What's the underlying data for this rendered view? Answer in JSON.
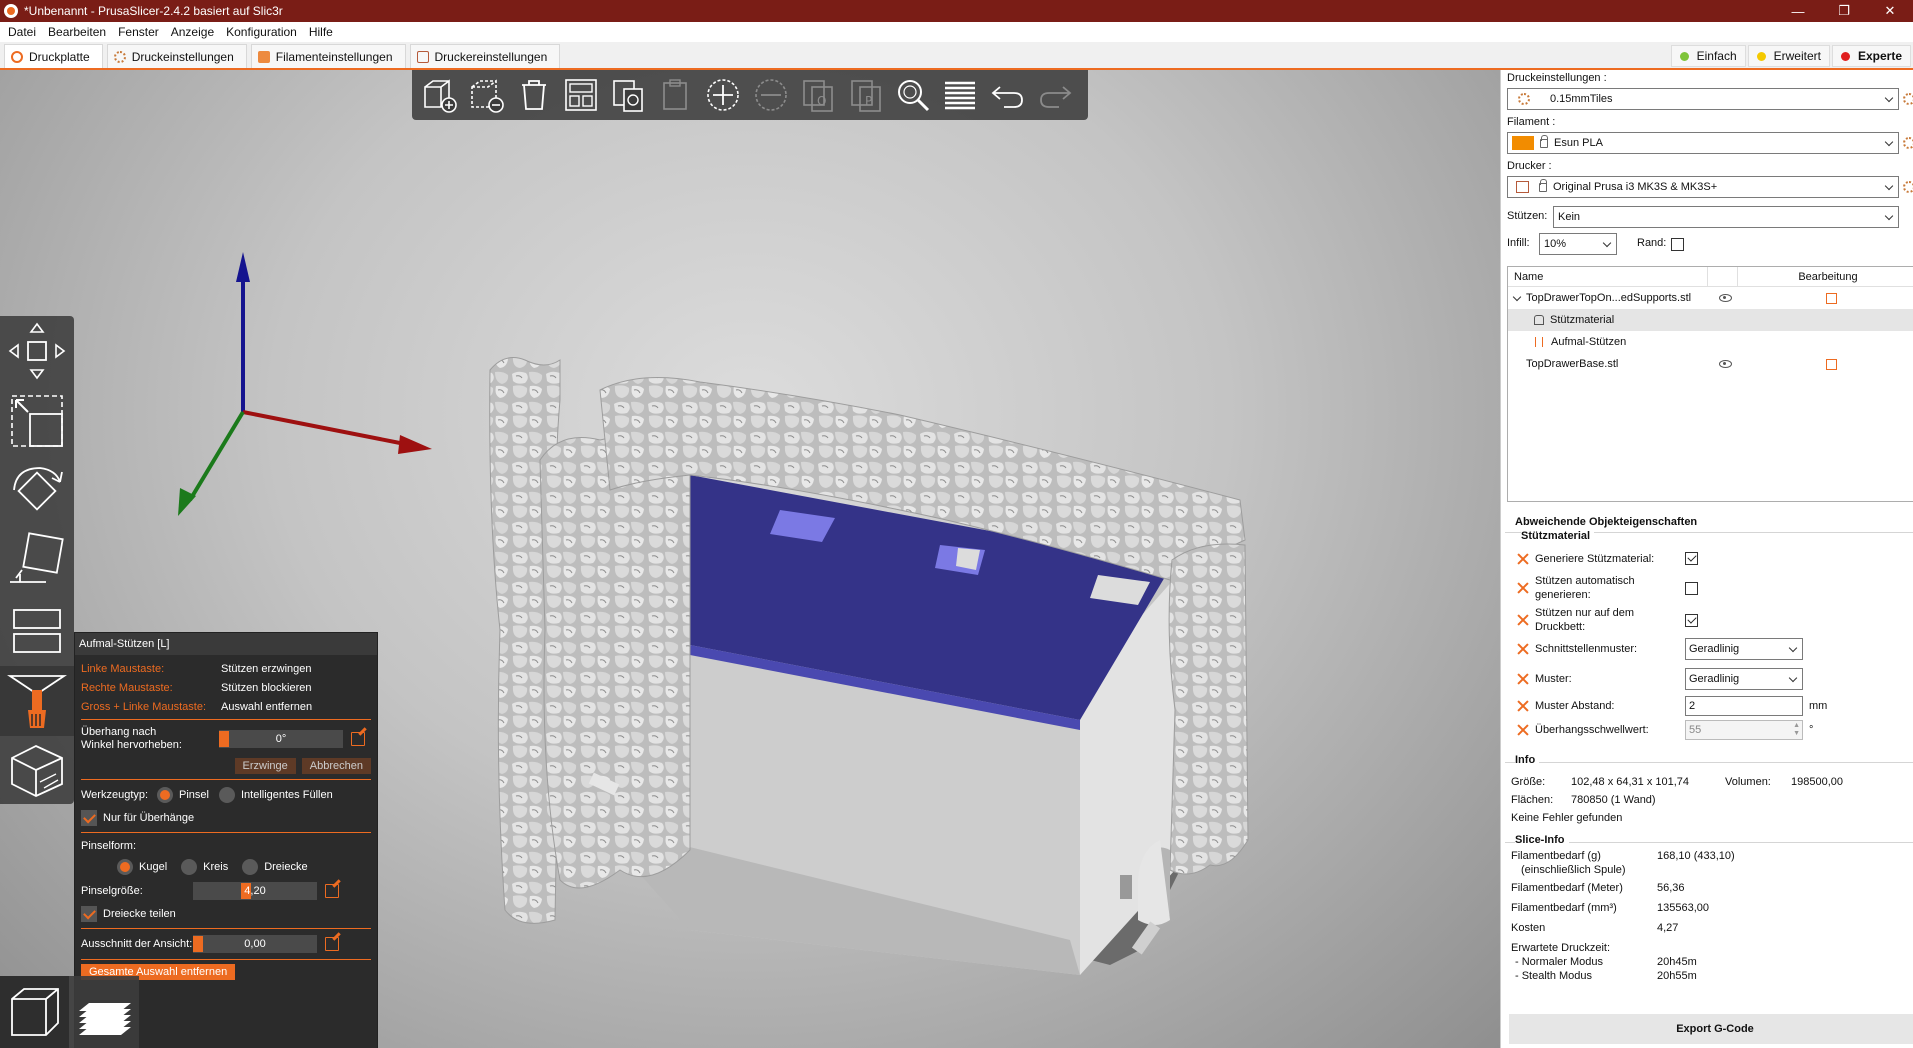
{
  "window": {
    "title": "*Unbenannt - PrusaSlicer-2.4.2 basiert auf Slic3r",
    "controls": [
      "—",
      "❐",
      "✕"
    ]
  },
  "menu": [
    "Datei",
    "Bearbeiten",
    "Fenster",
    "Anzeige",
    "Konfiguration",
    "Hilfe"
  ],
  "tabs": [
    {
      "label": "Druckplatte",
      "active": true
    },
    {
      "label": "Druckeinstellungen"
    },
    {
      "label": "Filamenteinstellungen"
    },
    {
      "label": "Druckereinstellungen"
    }
  ],
  "modes": [
    {
      "label": "Einfach",
      "color": "#7ec43a"
    },
    {
      "label": "Erweitert",
      "color": "#f4c900"
    },
    {
      "label": "Experte",
      "color": "#e01f1f"
    }
  ],
  "top_toolbar": [
    "add-icon",
    "delete-icon",
    "delete-all-icon",
    "arrange-icon",
    "copy-icon",
    "paste-icon",
    "add-instance-icon",
    "remove-instance-icon",
    "split-objects-icon",
    "split-parts-icon",
    "search-icon",
    "layers-icon",
    "undo-icon",
    "redo-icon"
  ],
  "left_toolbar": [
    "move-icon",
    "scale-icon",
    "rotate-icon",
    "place-on-face-icon",
    "cut-icon",
    "support-paint-icon",
    "seam-paint-icon"
  ],
  "gizmo": {
    "title": "Aufmal-Stützen [L]",
    "hints": [
      {
        "key": "Linke Maustaste:",
        "value": "Stützen erzwingen"
      },
      {
        "key": "Rechte Maustaste:",
        "value": "Stützen blockieren"
      },
      {
        "key": "Gross + Linke Maustaste:",
        "value": "Auswahl entfernen"
      }
    ],
    "overhang_label_1": "Überhang nach",
    "overhang_label_2": "Winkel hervorheben:",
    "overhang_value": "0°",
    "enforce_label": "Erzwinge",
    "cancel_label": "Abbrechen",
    "tool_type_label": "Werkzeugtyp:",
    "tool_brush": "Pinsel",
    "tool_smart": "Intelligentes Füllen",
    "overhang_only_label": "Nur für Überhänge",
    "brush_shape_label": "Pinselform:",
    "shape_sphere": "Kugel",
    "shape_circle": "Kreis",
    "shape_triangle": "Dreiecke",
    "brush_size_label": "Pinselgröße:",
    "brush_size_value": "4,20",
    "brush_size_fraction": 0.42,
    "split_triangles_label": "Dreiecke teilen",
    "clipping_label": "Ausschnitt der Ansicht:",
    "clipping_value": "0,00",
    "clear_all_label": "Gesamte Auswahl entfernen"
  },
  "right": {
    "print_settings_label": "Druckeinstellungen :",
    "print_settings_value": "0.15mmTiles",
    "filament_label": "Filament :",
    "filament_value": "Esun PLA",
    "filament_color": "#f28c00",
    "printer_label": "Drucker :",
    "printer_value": "Original Prusa i3 MK3S & MK3S+",
    "supports_label": "Stützen:",
    "supports_value": "Kein",
    "infill_label": "Infill:",
    "infill_value": "10%",
    "brim_label": "Rand:",
    "objlist": {
      "col_name": "Name",
      "col_edit": "Bearbeitung",
      "rows": [
        {
          "label": "TopDrawerTopOn...edSupports.stl"
        },
        {
          "label": "Stützmaterial"
        },
        {
          "label": "Aufmal-Stützen"
        },
        {
          "label": "TopDrawerBase.stl"
        }
      ]
    },
    "overrides_title": "Abweichende Objekteigenschaften",
    "support_section": "Stützmaterial",
    "props": {
      "generate_label": "Generiere Stützmaterial:",
      "auto_label_1": "Stützen automatisch",
      "auto_label_2": "generieren:",
      "buildplate_label_1": "Stützen nur auf dem",
      "buildplate_label_2": "Druckbett:",
      "interface_label": "Schnittstellenmuster:",
      "interface_value": "Geradlinig",
      "pattern_label": "Muster:",
      "pattern_value": "Geradlinig",
      "spacing_label": "Muster Abstand:",
      "spacing_value": "2",
      "spacing_unit": "mm",
      "threshold_label": "Überhangsschwellwert:",
      "threshold_value": "55",
      "threshold_unit": "°"
    },
    "info_title": "Info",
    "info": {
      "size_label": "Größe:",
      "size_value": "102,48 x 64,31 x 101,74",
      "volume_label": "Volumen:",
      "volume_value": "198500,00",
      "facets_label": "Flächen:",
      "facets_value": "780850 (1 Wand)",
      "errors": "Keine Fehler gefunden"
    },
    "slice_title": "Slice-Info",
    "slice": {
      "filament_g_label_1": "Filamentbedarf (g)",
      "filament_g_label_2": "(einschließlich Spule)",
      "filament_g_value": "168,10 (433,10)",
      "filament_m_label": "Filamentbedarf (Meter)",
      "filament_m_value": "56,36",
      "filament_mm3_label": "Filamentbedarf (mm³)",
      "filament_mm3_value": "135563,00",
      "cost_label": "Kosten",
      "cost_value": "4,27",
      "time_label": "Erwartete Druckzeit:",
      "normal_label": "- Normaler Modus",
      "normal_value": "20h45m",
      "stealth_label": "- Stealth Modus",
      "stealth_value": "20h55m"
    },
    "export_label": "Export G-Code"
  }
}
